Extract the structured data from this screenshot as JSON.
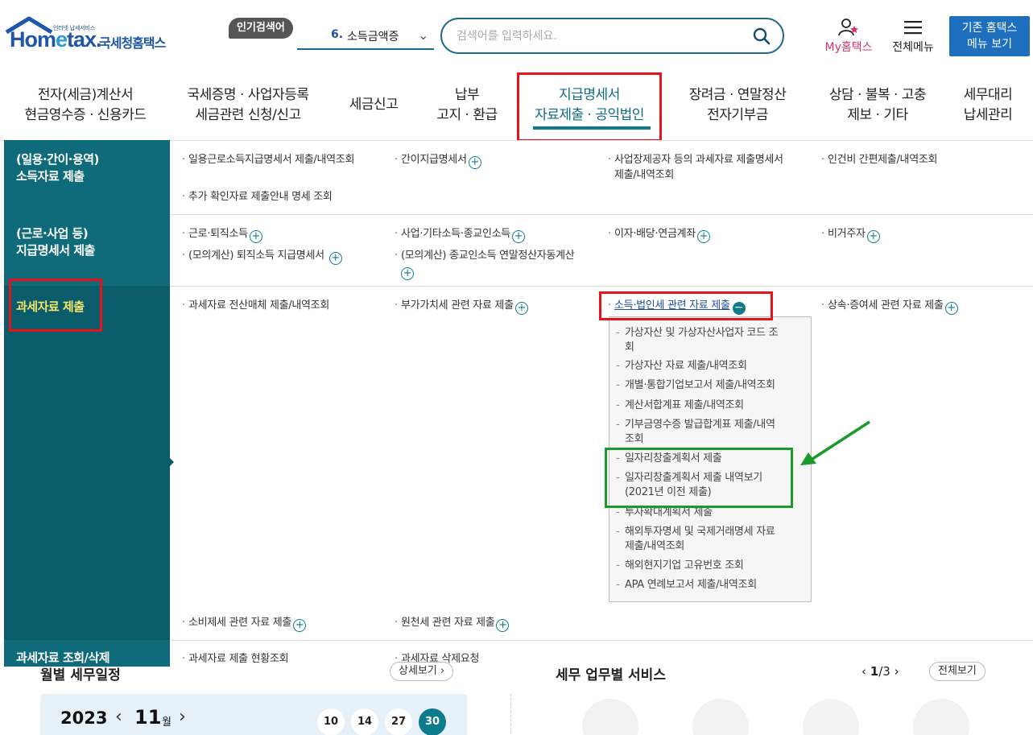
{
  "header": {
    "logo_sub": "인터넷 납세서비스",
    "logo_word_1": "Hom",
    "logo_word_e": "e",
    "logo_word_2": "tax.",
    "logo_kor": "국세청홈택스",
    "popular_badge": "인기검색어",
    "popular_rank": "6.",
    "popular_keyword": "소득금액증",
    "search_placeholder": "검색어를 입력하세요.",
    "my_label": "My홈택스",
    "all_menu_label": "전체메뉴",
    "legacy_line1": "기존 홈택스",
    "legacy_line2": "메뉴 보기"
  },
  "nav": [
    {
      "l1": "전자(세금)계산서",
      "l2": "현금영수증 · 신용카드"
    },
    {
      "l1": "국세증명 · 사업자등록",
      "l2": "세금관련 신청/신고"
    },
    {
      "l1": "세금신고",
      "l2": ""
    },
    {
      "l1": "납부",
      "l2": "고지 · 환급"
    },
    {
      "l1": "지급명세서",
      "l2": "자료제출 · 공익법인"
    },
    {
      "l1": "장려금 · 연말정산",
      "l2": "전자기부금"
    },
    {
      "l1": "상담 · 불복 · 고충",
      "l2": "제보 · 기타"
    },
    {
      "l1": "세무대리",
      "l2": "납세관리"
    }
  ],
  "sections": {
    "s1": {
      "l1": "(일용·간이·용역)",
      "l2": "소득자료 제출"
    },
    "s2": {
      "l1": "(근로·사업 등)",
      "l2": "지급명세서 제출"
    },
    "s3": {
      "l1": "과세자료 제출"
    },
    "s4": {
      "l1": "과세자료 조회/삭제"
    }
  },
  "menu_items": {
    "r1c1": "일용근로소득지급명세서 제출/내역조회",
    "r1c2": "간이지급명세서",
    "r1c3a": "사업장제공자 등의 과세자료 제출명세서",
    "r1c3b": "제출/내역조회",
    "r1c4": "인건비 간편제출/내역조회",
    "r1c1b": "추가 확인자료 제출안내 명세 조회",
    "r2c1": "근로·퇴직소득",
    "r2c2": "사업·기타소득·종교인소득",
    "r2c3": "이자·배당·연금계좌",
    "r2c4": "비거주자",
    "r2c1b": "(모의계산) 퇴직소득 지급명세서",
    "r2c2b": "(모의계산) 종교인소득 연말정산자동계산",
    "r3c1": "과세자료 전산매체 제출/내역조회",
    "r3c2": "부가가치세 관련 자료 제출",
    "r3c3": "소득·법인세 관련 자료 제출",
    "r3c4": "상속·증여세 관련 자료 제출",
    "r3c1b": "소비제세 관련 자료 제출",
    "r3c2b": "원천세 관련 자료 제출",
    "r4c1": "과세자료 제출 현황조회",
    "r4c2": "과세자료 삭제요청"
  },
  "submenu": [
    {
      "l1": "가상자산 및 가상자산사업자 코드 조",
      "l2": "회"
    },
    {
      "l1": "가상자산 자료 제출/내역조회",
      "l2": ""
    },
    {
      "l1": "개별·통합기업보고서 제출/내역조회",
      "l2": ""
    },
    {
      "l1": "계산서합계표 제출/내역조회",
      "l2": ""
    },
    {
      "l1": "기부금영수증 발급합계표 제출/내역",
      "l2": "조회"
    },
    {
      "l1": "일자리창출계획서 제출",
      "l2": ""
    },
    {
      "l1": "일자리창출계획서 제출 내역보기",
      "l2": "(2021년 이전 제출)"
    },
    {
      "l1": "투자확대계획서 제출",
      "l2": ""
    },
    {
      "l1": "해외투자명세 및 국제거래명세 자료",
      "l2": "제출/내역조회"
    },
    {
      "l1": "해외현지기업 고유번호 조회",
      "l2": ""
    },
    {
      "l1": "APA 연례보고서 제출/내역조회",
      "l2": ""
    }
  ],
  "bottom": {
    "left_title": "월별 세무일정",
    "left_more": "상세보기",
    "right_title": "세무 업무별 서비스",
    "page_cur": "1",
    "page_total": "/3",
    "right_more": "전체보기",
    "year": "2023",
    "month": "11",
    "month_unit": "월",
    "days": [
      "10",
      "14",
      "27",
      "30"
    ]
  },
  "colors": {
    "accent": "#0e7b8d",
    "sidebar": "#0a5c6b",
    "highlight_red": "#e8131a",
    "highlight_green": "#1a9a2a"
  }
}
